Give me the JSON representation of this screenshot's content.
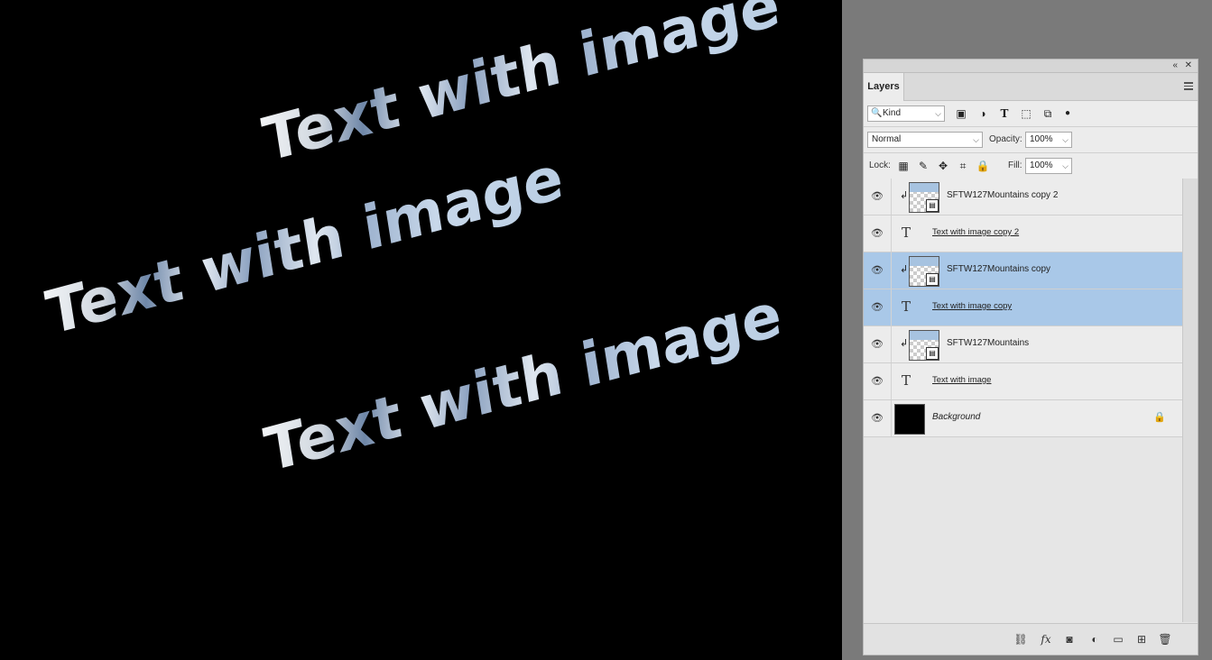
{
  "canvas": {
    "texts": [
      "Text with image",
      "Text with image",
      "Text with image"
    ]
  },
  "panel": {
    "tab_label": "Layers",
    "filter": {
      "kind_label": "Kind"
    },
    "blend": {
      "mode": "Normal",
      "opacity_label": "Opacity:",
      "opacity_value": "100%"
    },
    "lock": {
      "label": "Lock:",
      "fill_label": "Fill:",
      "fill_value": "100%"
    },
    "layers": [
      {
        "name": "SFTW127Mountains copy 2",
        "type": "smart",
        "selected": false
      },
      {
        "name": "Text with image copy 2",
        "type": "text",
        "selected": false
      },
      {
        "name": "SFTW127Mountains copy",
        "type": "smart",
        "selected": true
      },
      {
        "name": "Text with image copy",
        "type": "text",
        "selected": true
      },
      {
        "name": "SFTW127Mountains",
        "type": "smart",
        "selected": false
      },
      {
        "name": "Text with image",
        "type": "text",
        "selected": false
      },
      {
        "name": "Background",
        "type": "background",
        "selected": false
      }
    ]
  },
  "colors": {
    "selection": "#a9c8e8",
    "canvas": "#000000",
    "workspace": "#7a7a7a"
  },
  "icons": [
    "search-icon",
    "image-filter-icon",
    "adjustment-filter-icon",
    "type-filter-icon",
    "shape-filter-icon",
    "smart-filter-icon",
    "toggle-icon",
    "lock-pixels-icon",
    "brush-icon",
    "move-icon",
    "artboard-icon",
    "lock-icon",
    "eye-icon",
    "link-icon",
    "fx-icon",
    "mask-icon",
    "adjustment-icon",
    "folder-icon",
    "new-layer-icon",
    "trash-icon"
  ]
}
